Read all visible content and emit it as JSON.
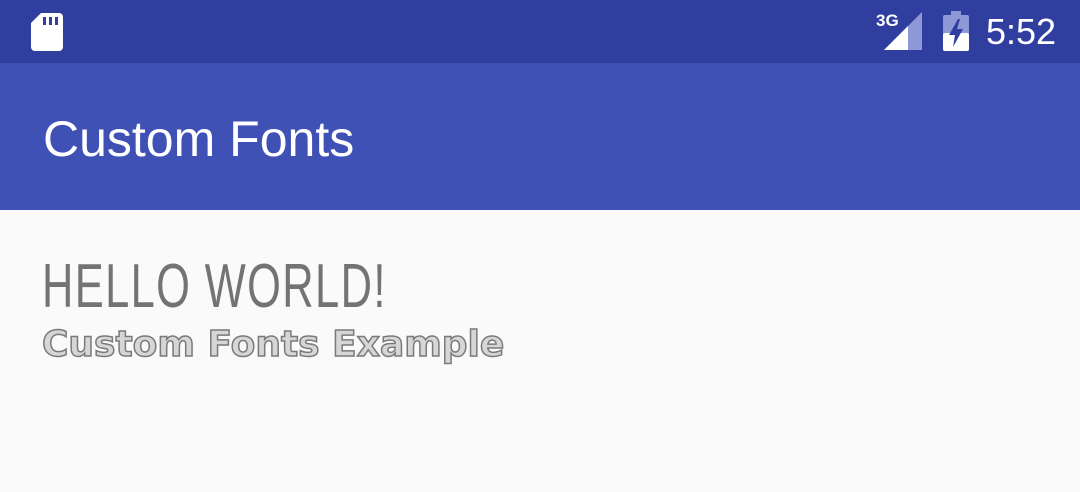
{
  "status_bar": {
    "network_type": "3G",
    "clock": "5:52",
    "icons": [
      "sd-card-icon",
      "signal-icon",
      "battery-charging-icon"
    ],
    "background": "#303f9f"
  },
  "app_bar": {
    "title": "Custom Fonts",
    "background": "#3f51b5"
  },
  "content": {
    "hello_text": "HELLO WORLD!",
    "subtitle_text": "Custom Fonts Example",
    "text_color": "#737373"
  }
}
